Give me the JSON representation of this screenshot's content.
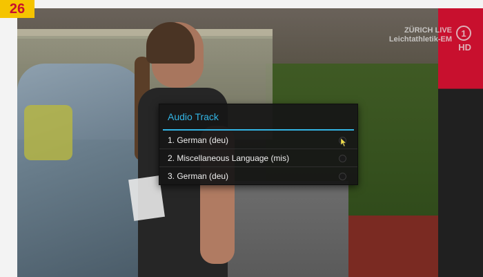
{
  "step_badge": "26",
  "broadcast": {
    "line1": "ZÜRICH LIVE",
    "line2": "Leichtathletik-EM",
    "channel_icon": "ard-hd-icon",
    "hd_label": "HD"
  },
  "dialog": {
    "title": "Audio Track",
    "options": [
      {
        "label": "1. German (deu)",
        "selected": false
      },
      {
        "label": "2. Miscellaneous Language (mis)",
        "selected": false
      },
      {
        "label": "3. German (deu)",
        "selected": false
      }
    ]
  },
  "colors": {
    "accent": "#33b5e5",
    "badge_bg": "#f5c400",
    "badge_text": "#c8102e"
  }
}
